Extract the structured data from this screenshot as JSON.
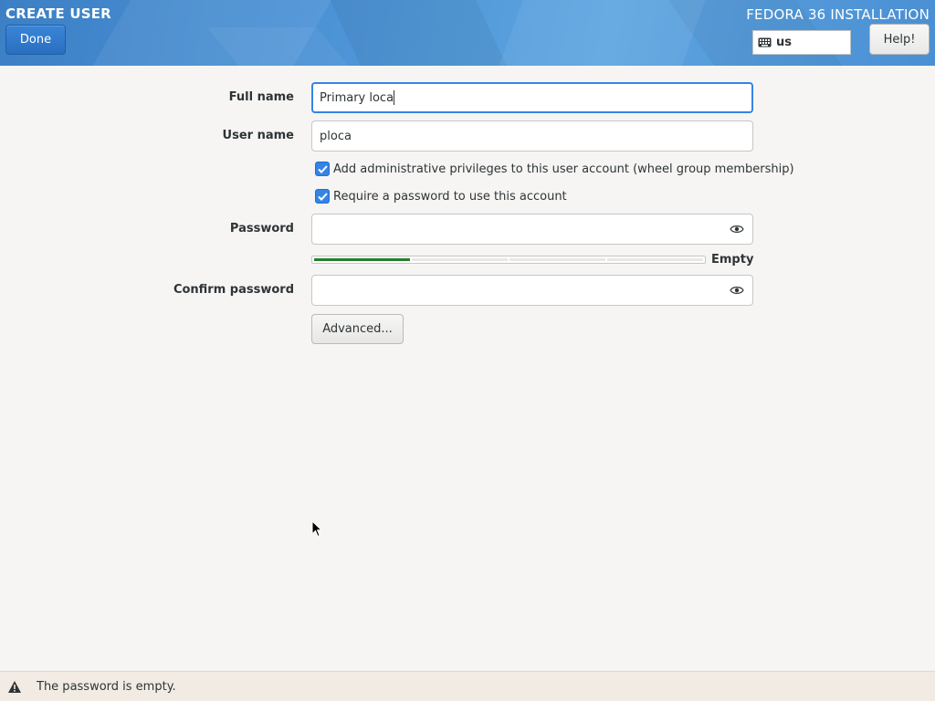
{
  "header": {
    "spoke_title": "CREATE USER",
    "done_label": "Done",
    "product_title": "FEDORA 36 INSTALLATION",
    "keyboard_layout": "us",
    "keyboard_icon": "keyboard-icon",
    "help_label": "Help!",
    "accent_color": "#4a8fd3"
  },
  "form": {
    "full_name": {
      "label": "Full name",
      "value": "Primary loca"
    },
    "user_name": {
      "label": "User name",
      "value": "ploca"
    },
    "admin_checkbox": {
      "label": "Add administrative privileges to this user account (wheel group membership)",
      "checked": true
    },
    "password_required_checkbox": {
      "label": "Require a password to use this account",
      "checked": true
    },
    "password": {
      "label": "Password",
      "value": "",
      "icon": "eye-icon"
    },
    "strength": {
      "label": "Empty",
      "segments_total": 4,
      "segments_filled": 1,
      "color": "#26802c"
    },
    "confirm_password": {
      "label": "Confirm password",
      "value": "",
      "icon": "eye-icon"
    },
    "advanced_label": "Advanced..."
  },
  "status_bar": {
    "icon": "warning-icon",
    "message": "The password is empty."
  }
}
